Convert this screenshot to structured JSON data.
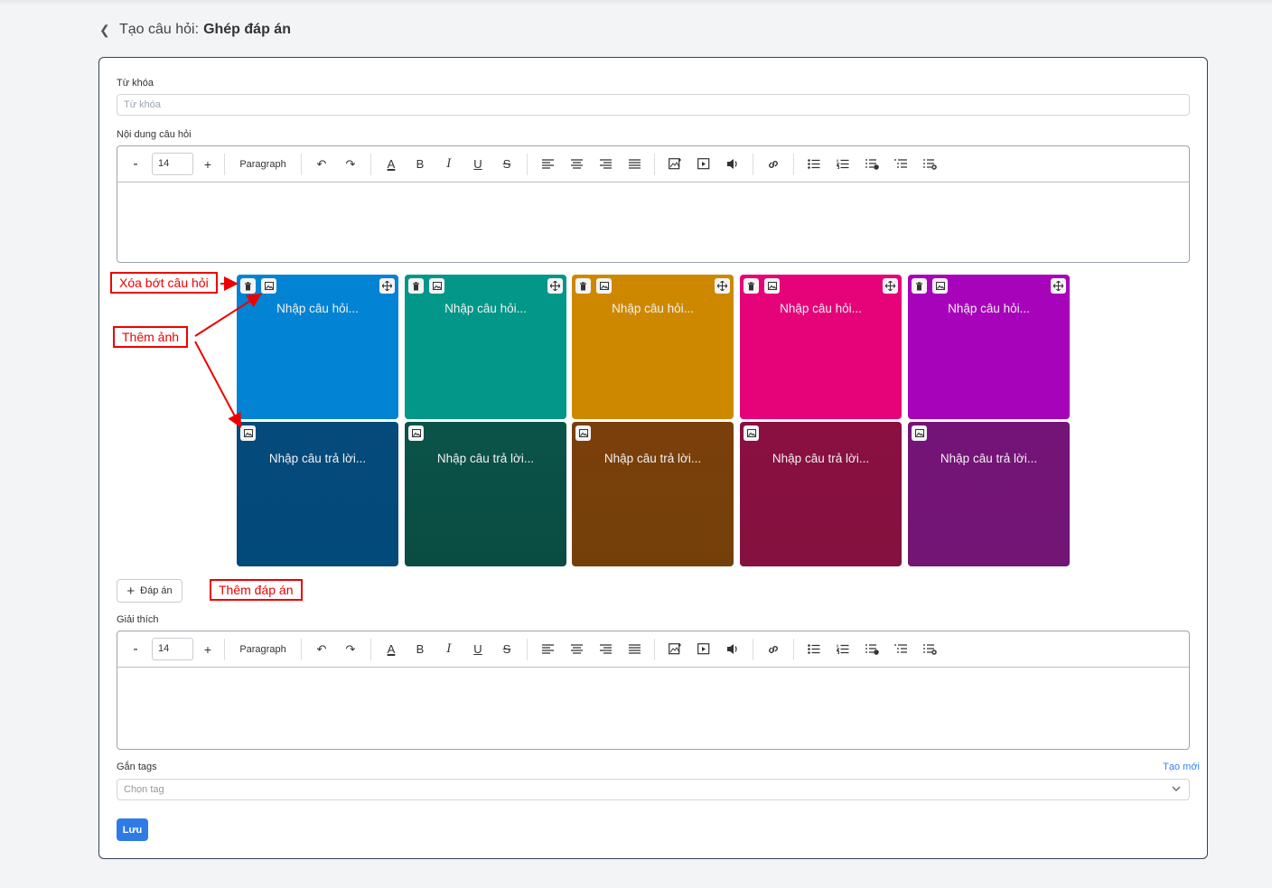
{
  "header": {
    "back_icon": "chevron-left-icon",
    "title_prefix": "Tạo câu hỏi:",
    "title_bold": "Ghép đáp án"
  },
  "keyword": {
    "label": "Từ khóa",
    "placeholder": "Từ khóa"
  },
  "content": {
    "label": "Nội dung câu hỏi"
  },
  "toolbar": {
    "minus": "-",
    "font_size": "14",
    "plus": "+",
    "paragraph": "Paragraph",
    "icons": [
      "undo-icon",
      "redo-icon",
      "text-color-icon",
      "bold-icon",
      "italic-icon",
      "underline-icon",
      "strikethrough-icon",
      "align-left-icon",
      "align-center-icon",
      "align-right-icon",
      "align-justify-icon",
      "insert-image-icon",
      "insert-video-icon",
      "insert-audio-icon",
      "link-icon",
      "bullet-list-icon",
      "numbered-list-icon",
      "add-list-icon",
      "indent-list-icon",
      "remove-list-icon"
    ]
  },
  "pairs": {
    "question_placeholder": "Nhập câu hỏi...",
    "answer_placeholder": "Nhập câu trả lời...",
    "question_colors": [
      "#0283d3",
      "#029788",
      "#ce8800",
      "#e6037a",
      "#a703ba"
    ],
    "answer_colors_top": [
      "#054a7b",
      "#0b5349",
      "#7b3f0b",
      "#8a1040",
      "#741478"
    ],
    "answer_colors_bottom": [
      "#024a7a",
      "#0a4c42",
      "#74400a",
      "#84113f",
      "#721575"
    ]
  },
  "annotations": {
    "delete": "Xóa bớt câu hỏi",
    "add_image": "Thêm ảnh",
    "add_answer": "Thêm đáp án",
    "color": "#e00000"
  },
  "add_answer_button": {
    "icon": "plus-icon",
    "label": "Đáp án"
  },
  "explanation": {
    "label": "Giải thích"
  },
  "tags": {
    "label": "Gắn tags",
    "create_new": "Tạo mới",
    "placeholder": "Chọn tag"
  },
  "save_button": {
    "label": "Lưu",
    "color": "#2f7be5"
  }
}
